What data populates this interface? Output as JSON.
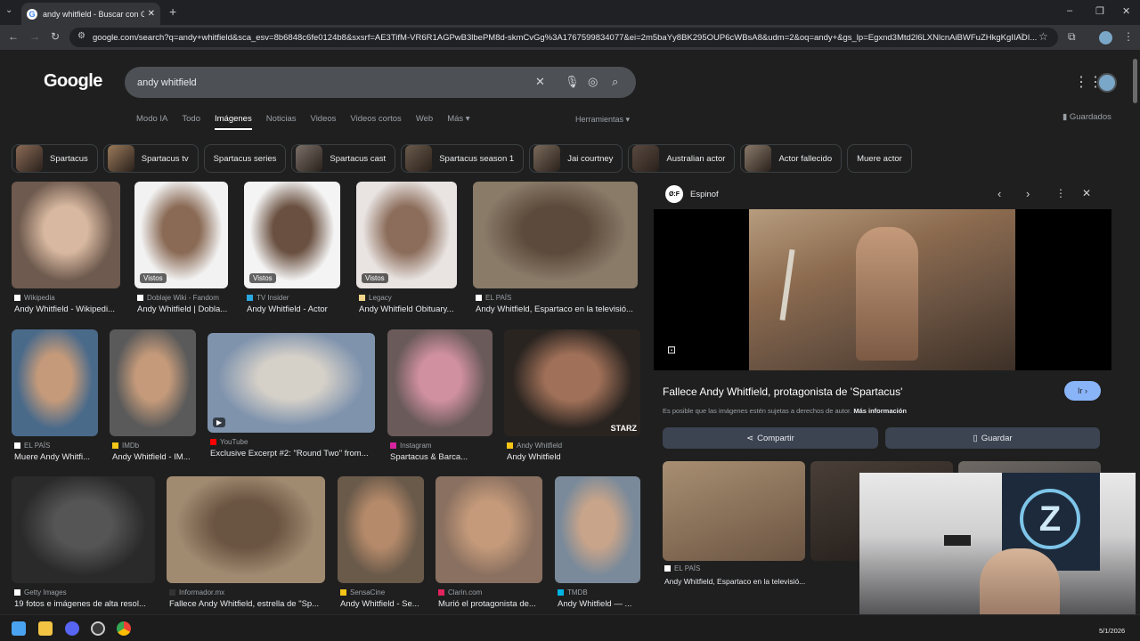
{
  "browser": {
    "tab_title": "andy whitfield - Buscar con Goo",
    "url": "google.com/search?q=andy+whitfield&sca_esv=8b6848c6fe0124b8&sxsrf=AE3TifM-VR6R1AGPwB3lbePM8d-skmCvGg%3A1767599834077&ei=2m5baYy8BK295OUP6cWBsA8&udm=2&oq=andy+&gs_lp=Egxnd3Mtd2l6LXNlcnAiBWFuZHkgKgIIADI...",
    "new_tab": "+",
    "window_controls": [
      "–",
      "❐",
      "✕"
    ]
  },
  "google": {
    "logo": "Google",
    "query": "andy whitfield",
    "nav_tabs": [
      "Modo IA",
      "Todo",
      "Imágenes",
      "Noticias",
      "Videos",
      "Videos cortos",
      "Web",
      "Más ▾"
    ],
    "active_tab": "Imágenes",
    "tools": "Herramientas ▾",
    "saved": "Guardados"
  },
  "chips": [
    "Spartacus",
    "Spartacus tv",
    "Spartacus series",
    "Spartacus cast",
    "Spartacus season 1",
    "Jai courtney",
    "Australian actor",
    "Actor fallecido",
    "Muere actor"
  ],
  "chips_with_thumb": [
    true,
    true,
    false,
    true,
    true,
    true,
    true,
    true,
    false
  ],
  "results": [
    {
      "source": "Wikipedia",
      "caption": "Andy Whitfield - Wikipedi...",
      "vistos": ""
    },
    {
      "source": "Doblaje Wiki - Fandom",
      "caption": "Andy Whitfield | Dobla...",
      "vistos": "Vistos"
    },
    {
      "source": "TV Insider",
      "caption": "Andy Whitfield - Actor",
      "vistos": "Vistos"
    },
    {
      "source": "Legacy",
      "caption": "Andy Whitfield Obituary...",
      "vistos": "Vistos"
    },
    {
      "source": "EL PAÍS",
      "caption": "Andy Whitfield, Espartaco en la televisió...",
      "vistos": ""
    },
    {
      "source": "EL PAÍS",
      "caption": "Muere Andy Whitfi...",
      "vistos": ""
    },
    {
      "source": "IMDb",
      "caption": "Andy Whitfield - IM...",
      "vistos": ""
    },
    {
      "source": "YouTube",
      "caption": "Exclusive Excerpt #2: \"Round Two\" from...",
      "vistos": ""
    },
    {
      "source": "Instagram",
      "caption": "Spartacus & Barca...",
      "vistos": ""
    },
    {
      "source": "Andy Whitfield",
      "caption": "Andy Whitfield",
      "vistos": ""
    },
    {
      "source": "Getty Images",
      "caption": "19 fotos e imágenes de alta resol...",
      "vistos": ""
    },
    {
      "source": "Informador.mx",
      "caption": "Fallece Andy Whitfield, estrella de \"Sp...",
      "vistos": ""
    },
    {
      "source": "SensaCine",
      "caption": "Andy Whitfield - Se...",
      "vistos": ""
    },
    {
      "source": "Clarin.com",
      "caption": "Murió el protagonista de...",
      "vistos": ""
    },
    {
      "source": "TMDB",
      "caption": "Andy Whitfield — ...",
      "vistos": ""
    }
  ],
  "starz": "STARZ",
  "panel": {
    "site": "Espinof",
    "site_badge": "Ø:F",
    "title": "Fallece Andy Whitfield, protagonista de 'Spartacus'",
    "go_button": "Ir ›",
    "disclaimer": "Es posible que las imágenes estén sujetas a derechos de autor.",
    "more_info": "Más información",
    "share": "Compartir",
    "save": "Guardar",
    "related_source": "EL PAÍS",
    "related_caption": "Andy Whitfield, Espartaco en la televisió..."
  },
  "taskbar": {
    "date": "5/1/2026"
  },
  "colors": {
    "page_bg": "#1f1f1f",
    "accent_blue": "#8ab4f8",
    "button_bg": "#303134"
  }
}
